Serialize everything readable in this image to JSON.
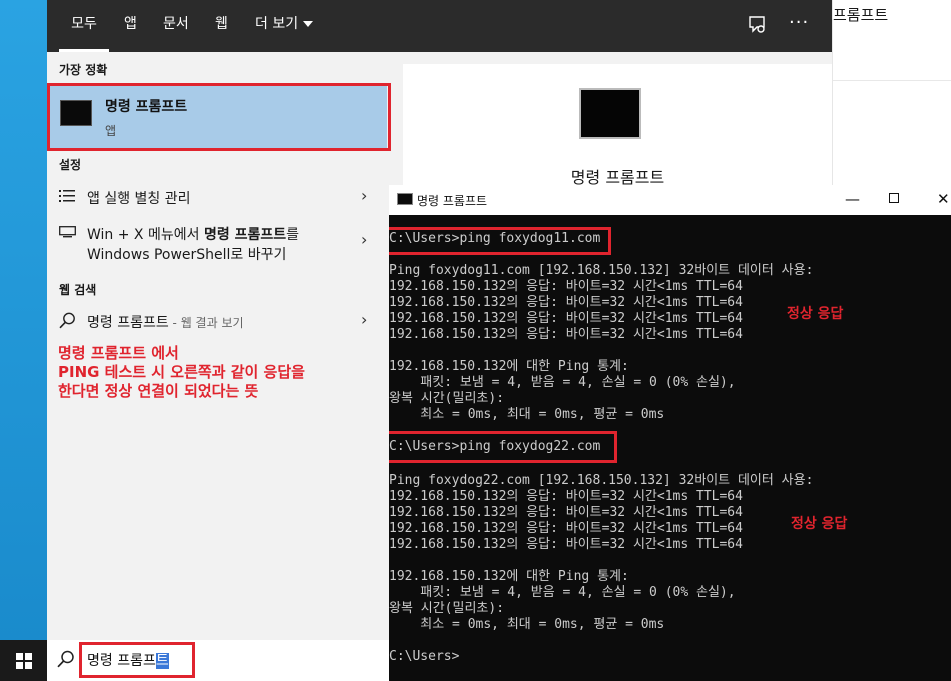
{
  "background_window": {
    "text": "프롬프트"
  },
  "search_panel": {
    "tabs": [
      {
        "label": "모두"
      },
      {
        "label": "앱"
      },
      {
        "label": "문서"
      },
      {
        "label": "웹"
      },
      {
        "label": "더 보기"
      }
    ],
    "more_icon": "···",
    "best_match_heading": "가장 정확",
    "best_match": {
      "title": "명령 프롬프트",
      "subtitle": "앱"
    },
    "settings_heading": "설정",
    "settings_items": [
      {
        "label": "앱 실행 별칭 관리"
      },
      {
        "label_line1_a": "Win + X 메뉴에서 ",
        "label_line1_b": "명령 프롬프트",
        "label_line1_c": "를",
        "label_line2": "Windows PowerShell로 바꾸기"
      }
    ],
    "web_heading": "웹 검색",
    "web_item": {
      "label": "명령 프롬프트",
      "sub": " - 웹 결과 보기"
    },
    "annotation": [
      "명령 프롬프트 에서",
      "PING 테스트 시 오른쪽과 같이 응답을",
      "한다면 정상 연결이 되었다는 뜻"
    ],
    "preview_title": "명령 프롬프트",
    "search": {
      "text_before": "명령 프롬프",
      "text_selected": "트"
    }
  },
  "cmd_window": {
    "title": "명령 프롬프트",
    "controls": {
      "minimize": "—",
      "close": "✕"
    },
    "normal_label": "정상 응답",
    "lines": [
      "C:\\Users>ping foxydog11.com",
      "",
      "Ping foxydog11.com [192.168.150.132] 32바이트 데이터 사용:",
      "192.168.150.132의 응답: 바이트=32 시간<1ms TTL=64",
      "192.168.150.132의 응답: 바이트=32 시간<1ms TTL=64",
      "192.168.150.132의 응답: 바이트=32 시간<1ms TTL=64",
      "192.168.150.132의 응답: 바이트=32 시간<1ms TTL=64",
      "",
      "192.168.150.132에 대한 Ping 통계:",
      "    패킷: 보냄 = 4, 받음 = 4, 손실 = 0 (0% 손실),",
      "왕복 시간(밀리초):",
      "    최소 = 0ms, 최대 = 0ms, 평균 = 0ms",
      "",
      "C:\\Users>ping foxydog22.com",
      "",
      "Ping foxydog22.com [192.168.150.132] 32바이트 데이터 사용:",
      "192.168.150.132의 응답: 바이트=32 시간<1ms TTL=64",
      "192.168.150.132의 응답: 바이트=32 시간<1ms TTL=64",
      "192.168.150.132의 응답: 바이트=32 시간<1ms TTL=64",
      "192.168.150.132의 응답: 바이트=32 시간<1ms TTL=64",
      "",
      "192.168.150.132에 대한 Ping 통계:",
      "    패킷: 보냄 = 4, 받음 = 4, 손실 = 0 (0% 손실),",
      "왕복 시간(밀리초):",
      "    최소 = 0ms, 최대 = 0ms, 평균 = 0ms",
      "",
      "C:\\Users>"
    ]
  },
  "colors": {
    "highlight": "#e0242e",
    "selection": "#a8cbe8",
    "tabbar": "#2b2b2b",
    "console_bg": "#0c0c0c",
    "console_fg": "#cccccc"
  }
}
